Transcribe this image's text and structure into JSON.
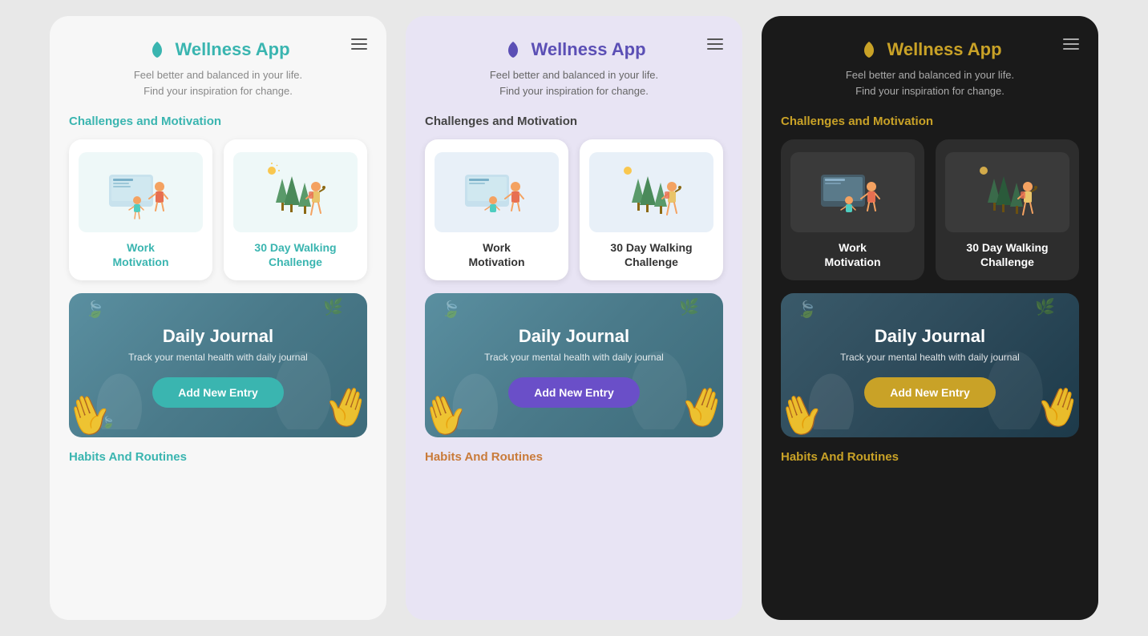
{
  "app": {
    "name": "Wellness App",
    "tagline": "Feel better and balanced in your life.\nFind your inspiration for change.",
    "logo_alt": "leaf icon"
  },
  "sections": {
    "challenges_title": "Challenges and Motivation",
    "challenges": [
      {
        "name": "Work\nMotivation",
        "icon": "💼",
        "id": "work-motivation"
      },
      {
        "name": "30 Day Walking\nChallenge",
        "icon": "🥾",
        "id": "walking-challenge"
      }
    ],
    "journal": {
      "title": "Daily Journal",
      "subtitle": "Track your mental health with daily journal",
      "button_label": "Add New Entry"
    },
    "habits_title": "Habits And Routines"
  },
  "themes": [
    {
      "name": "light",
      "label": "Light Theme"
    },
    {
      "name": "purple",
      "label": "Purple Theme"
    },
    {
      "name": "dark",
      "label": "Dark Theme"
    }
  ]
}
